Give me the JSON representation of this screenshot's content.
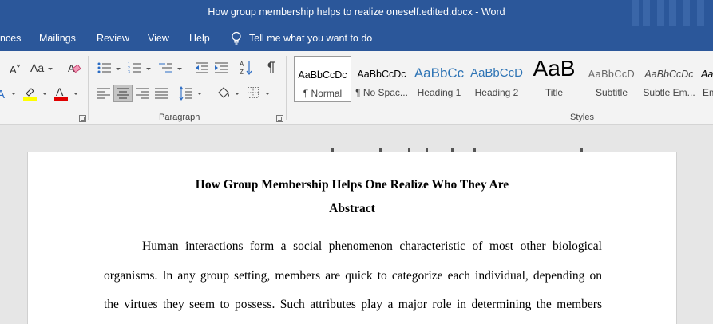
{
  "window": {
    "title": "How group membership helps to realize oneself.edited.docx  -  Word"
  },
  "tabs": [
    {
      "label": "nces"
    },
    {
      "label": "Mailings"
    },
    {
      "label": "Review"
    },
    {
      "label": "View"
    },
    {
      "label": "Help"
    }
  ],
  "tell_me": {
    "label": "Tell me what you want to do"
  },
  "ribbon": {
    "font_group": {
      "case_label": "Aa"
    },
    "paragraph_group": {
      "label": "Paragraph"
    },
    "styles_group": {
      "label": "Styles",
      "items": [
        {
          "sample": "AaBbCcDc",
          "name": "¶ Normal"
        },
        {
          "sample": "AaBbCcDc",
          "name": "¶ No Spac..."
        },
        {
          "sample": "AaBbCc",
          "name": "Heading 1"
        },
        {
          "sample": "AaBbCcD",
          "name": "Heading 2"
        },
        {
          "sample": "AaB",
          "name": "Title"
        },
        {
          "sample": "AaBbCcD",
          "name": "Subtitle"
        },
        {
          "sample": "AaBbCcDc",
          "name": "Subtle Em..."
        },
        {
          "sample": "AaI",
          "name": "Em"
        }
      ]
    }
  },
  "document": {
    "title": "How Group Membership Helps One Realize Who They Are",
    "abstract_heading": "Abstract",
    "lines": [
      "Human interactions form a social phenomenon characteristic of most other biological",
      "organisms. In any group setting, members are quick to categorize each individual, depending on",
      "the virtues they seem to possess. Such attributes play a major role in determining the members"
    ]
  },
  "colors": {
    "accent": "#2b579a",
    "highlight": "#ffff00",
    "font_color": "#e00000"
  }
}
